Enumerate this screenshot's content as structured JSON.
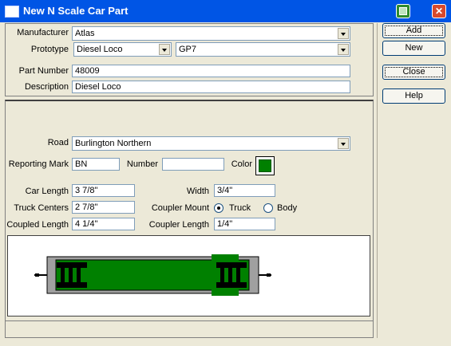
{
  "window": {
    "title": "New N Scale Car Part",
    "close_glyph": "✕"
  },
  "top": {
    "manufacturer_label": "Manufacturer",
    "manufacturer_value": "Atlas",
    "prototype_label": "Prototype",
    "prototype_value": "Diesel Loco",
    "prototype_model": "GP7",
    "part_number_label": "Part Number",
    "part_number_value": "48009",
    "description_label": "Description",
    "description_value": "Diesel Loco"
  },
  "details": {
    "road_label": "Road",
    "road_value": "Burlington Northern",
    "reporting_mark_label": "Reporting Mark",
    "reporting_mark_value": "BN",
    "number_label": "Number",
    "number_value": "",
    "color_label": "Color",
    "color_value": "#008000",
    "car_length_label": "Car Length",
    "car_length_value": "3 7/8\"",
    "width_label": "Width",
    "width_value": "3/4\"",
    "truck_centers_label": "Truck Centers",
    "truck_centers_value": "2 7/8\"",
    "coupler_mount_label": "Coupler Mount",
    "coupler_mount_options": [
      "Truck",
      "Body"
    ],
    "coupler_mount_selected": "Truck",
    "coupled_length_label": "Coupled Length",
    "coupled_length_value": "4 1/4\"",
    "coupler_length_label": "Coupler Length",
    "coupler_length_value": "1/4\""
  },
  "buttons": {
    "add": "Add",
    "new": "New",
    "close": "Close",
    "help": "Help"
  },
  "colors": {
    "titlebar": "#0055e5",
    "car_body": "#008000",
    "frame": "#a0a0a0"
  }
}
